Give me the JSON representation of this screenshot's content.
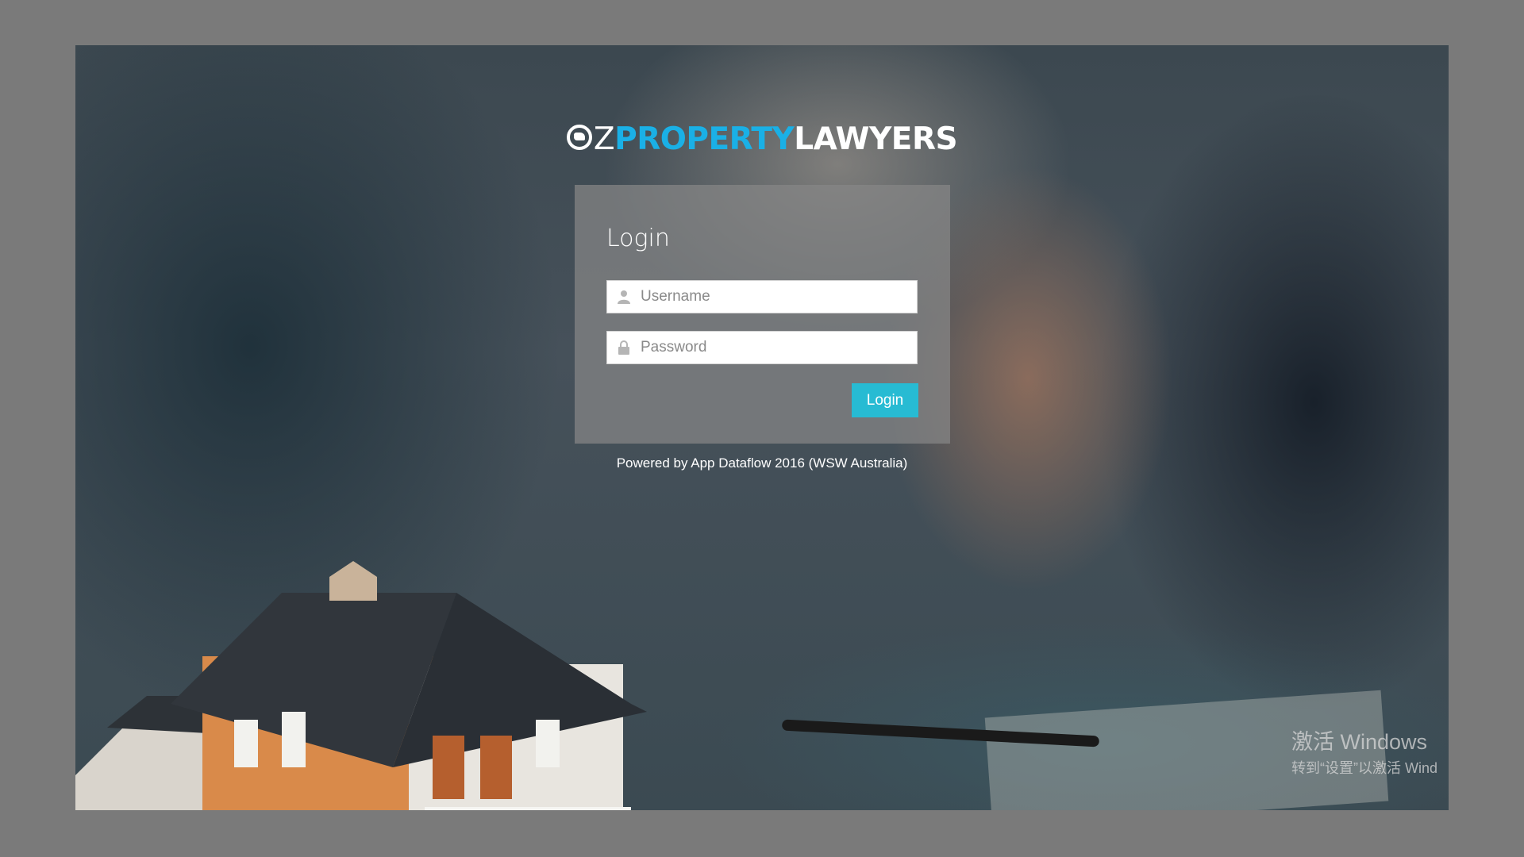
{
  "logo": {
    "oz": "Z",
    "property": "PROPERTY",
    "lawyers": "LAWYERS"
  },
  "login": {
    "title": "Login",
    "username_placeholder": "Username",
    "password_placeholder": "Password",
    "username_value": "",
    "password_value": "",
    "button_label": "Login"
  },
  "footer": {
    "powered_by": "Powered by App Dataflow 2016 (WSW Australia)"
  },
  "watermark": {
    "title": "激活 Windows",
    "subtitle": "转到“设置”以激活 Wind"
  },
  "icons": {
    "username": "user-icon",
    "password": "lock-icon"
  },
  "colors": {
    "accent": "#27bbd3",
    "brand_blue": "#1ab0e6"
  }
}
